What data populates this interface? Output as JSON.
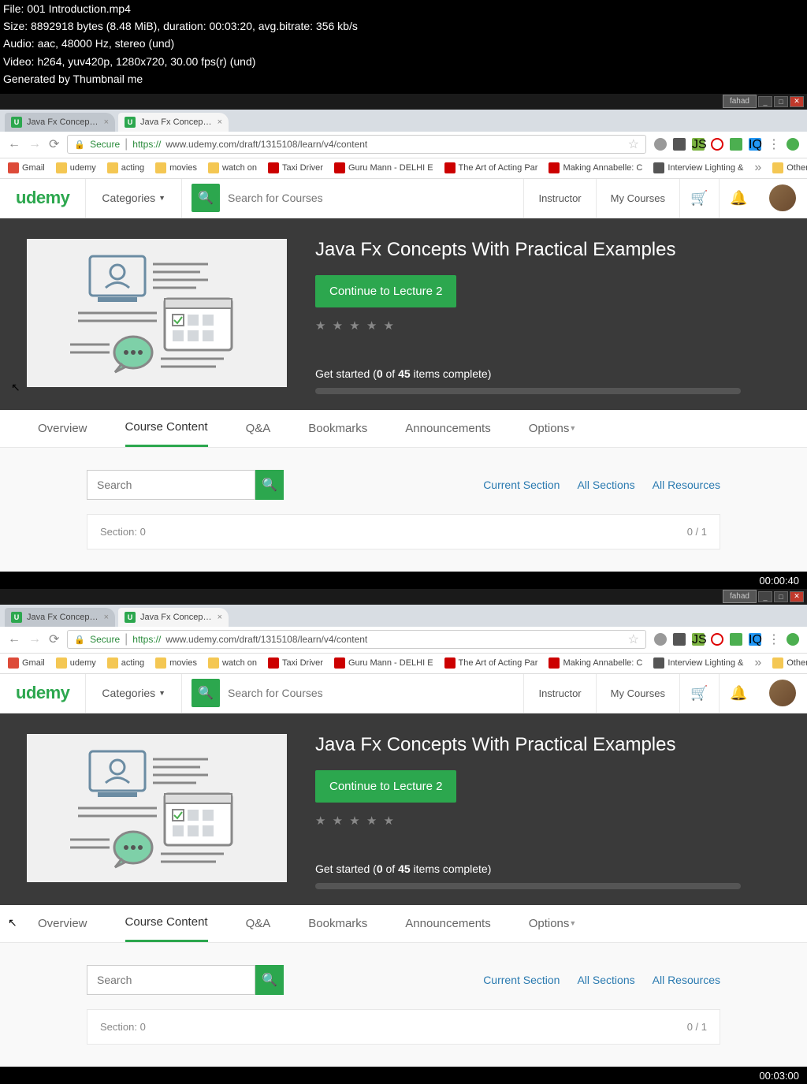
{
  "meta": {
    "line1": "File: 001 Introduction.mp4",
    "line2": "Size: 8892918 bytes (8.48 MiB), duration: 00:03:20, avg.bitrate: 356 kb/s",
    "line3": "Audio: aac, 48000 Hz, stereo (und)",
    "line4": "Video: h264, yuv420p, 1280x720, 30.00 fps(r) (und)",
    "line5": "Generated by Thumbnail me"
  },
  "window": {
    "user": "fahad"
  },
  "tabs": [
    {
      "label": "Java Fx Concepts With P..."
    },
    {
      "label": "Java Fx Concepts With P..."
    }
  ],
  "address": {
    "secure": "Secure",
    "url_prefix": "https://",
    "url": "www.udemy.com/draft/1315108/learn/v4/content"
  },
  "bookmarks": {
    "gmail": "Gmail",
    "udemy": "udemy",
    "acting": "acting",
    "movies": "movies",
    "watchon": "watch on",
    "taxi": "Taxi Driver",
    "guru": "Guru Mann - DELHI E",
    "artacting": "The Art of Acting Par",
    "annabelle": "Making Annabelle: C",
    "lighting": "Interview Lighting &",
    "other": "Other bookmarks"
  },
  "header": {
    "logo": "udemy",
    "categories": "Categories",
    "search_placeholder": "Search for Courses",
    "instructor": "Instructor",
    "mycourses": "My Courses"
  },
  "hero": {
    "title": "Java Fx Concepts With Practical Examples",
    "button": "Continue to Lecture 2",
    "progress_prefix": "Get started (",
    "progress_done": "0",
    "progress_of": " of ",
    "progress_total": "45",
    "progress_suffix": " items complete)"
  },
  "course_tabs": {
    "overview": "Overview",
    "content": "Course Content",
    "qa": "Q&A",
    "bookmarks": "Bookmarks",
    "announcements": "Announcements",
    "options": "Options"
  },
  "section": {
    "search_placeholder": "Search",
    "current": "Current Section",
    "all": "All Sections",
    "resources": "All Resources",
    "label": "Section: 0",
    "count": "0 / 1"
  },
  "timestamps": {
    "frame1": "00:00:40",
    "frame2": "00:03:00"
  }
}
